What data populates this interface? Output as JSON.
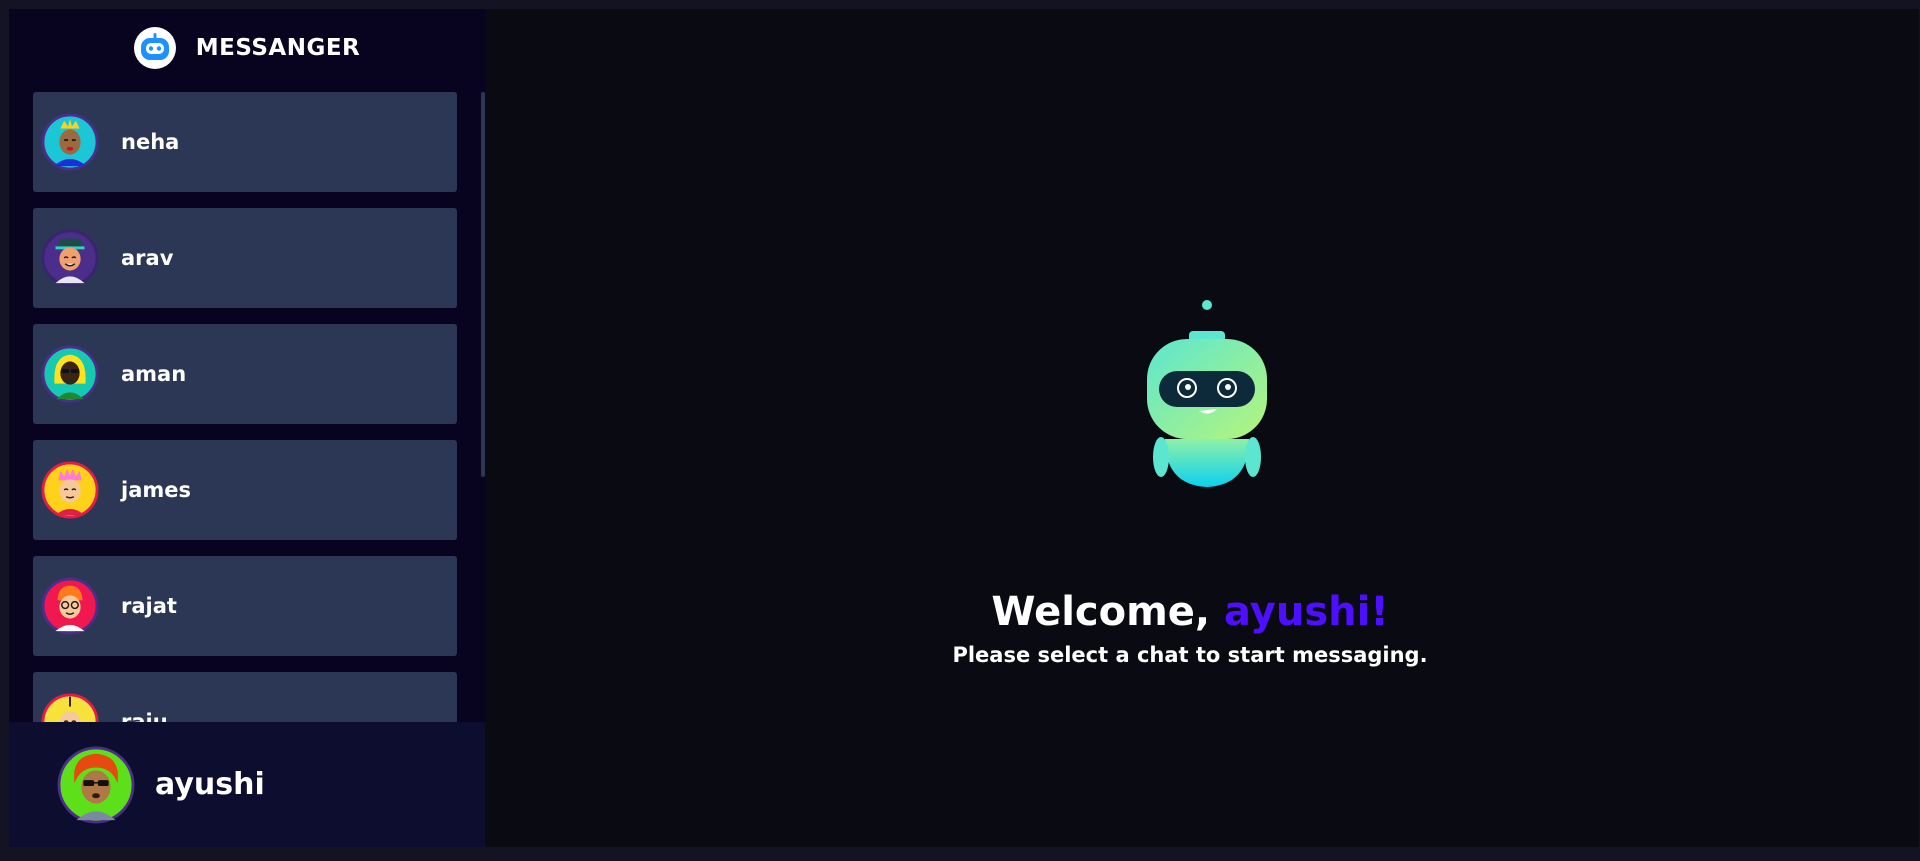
{
  "brand": {
    "title": "MESSANGER",
    "icon": "robot-logo-icon"
  },
  "contacts": [
    {
      "name": "neha",
      "avatar": "avatar-neha",
      "bg": "#1bc6d6"
    },
    {
      "name": "arav",
      "avatar": "avatar-arav",
      "bg": "#4b2d8a"
    },
    {
      "name": "aman",
      "avatar": "avatar-aman",
      "bg": "#16c9b0"
    },
    {
      "name": "james",
      "avatar": "avatar-james",
      "bg": "#ffd21a"
    },
    {
      "name": "rajat",
      "avatar": "avatar-rajat",
      "bg": "#f0184f"
    },
    {
      "name": "raju",
      "avatar": "avatar-raju",
      "bg": "#f7e13b"
    }
  ],
  "current_user": {
    "name": "ayushi",
    "avatar": "avatar-ayushi",
    "bg": "#5de01a"
  },
  "welcome": {
    "greeting": "Welcome, ",
    "username": "ayushi!",
    "subtitle": "Please select a chat to start messaging."
  },
  "colors": {
    "accent": "#4e0eff",
    "card": "#2b3754",
    "sidebar": "#080420",
    "main": "#0a0a13"
  }
}
